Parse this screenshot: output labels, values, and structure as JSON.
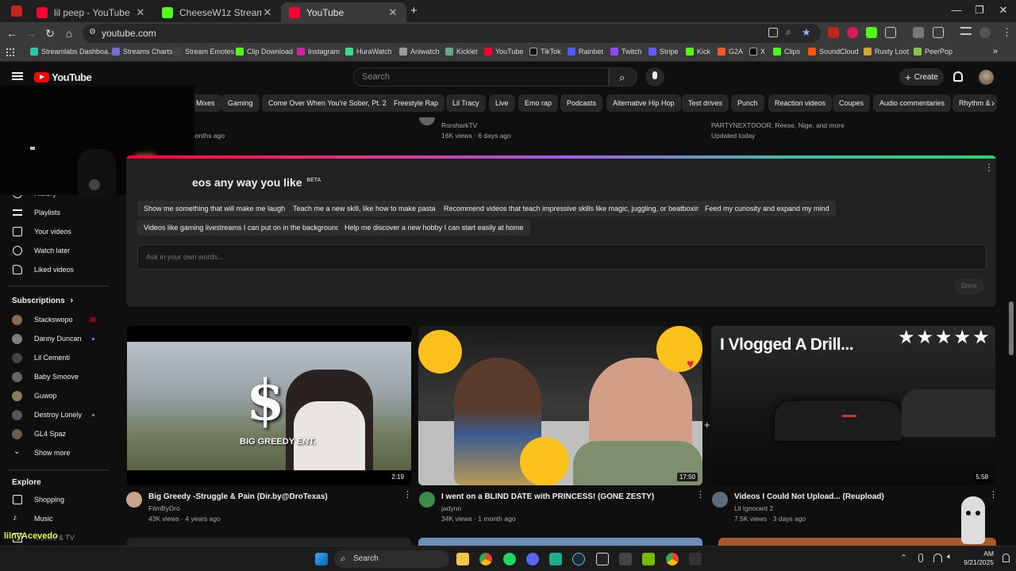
{
  "browser": {
    "tabs": [
      {
        "title": "lil peep - YouTube",
        "active": false
      },
      {
        "title": "CheeseW1z Stream - Watch Live",
        "active": false
      },
      {
        "title": "YouTube",
        "active": true
      }
    ],
    "url": "youtube.com",
    "bookmarks": [
      "Streamlabs Dashboa...",
      "Streams Charts",
      "Stream Emotes",
      "Clip Download",
      "Instagram",
      "HuraWatch",
      "Aniwatch",
      "Kicklet",
      "YouTube",
      "TikTok",
      "Rainbet",
      "Twitch",
      "Stripe",
      "Kick",
      "G2A",
      "X",
      "Clips",
      "SoundCloud",
      "Rusty Loot",
      "PeerPop"
    ]
  },
  "header": {
    "logo": "YouTube",
    "search_placeholder": "Search",
    "create_label": "Create"
  },
  "chips": [
    "Mixes",
    "Gaming",
    "Come Over When You're Sober, Pt. 2",
    "Freestyle Rap",
    "Lil Tracy",
    "Live",
    "Emo rap",
    "Podcasts",
    "Alternative Hip Hop",
    "Test drives",
    "Punch",
    "Reaction videos",
    "Coupes",
    "Audio commentaries",
    "Rhythm &"
  ],
  "top_row": [
    {
      "meta": "nonths ago"
    },
    {
      "channel": "RorsharkTV",
      "meta": "16K views · 6 days ago"
    },
    {
      "channel": "PARTYNEXTDOOR, Reese, Nige, and more",
      "meta": "Updated today"
    }
  ],
  "sidebar": {
    "partial_top": "History",
    "items": [
      "Playlists",
      "Your videos",
      "Watch later",
      "Liked videos"
    ],
    "subscriptions_label": "Subscriptions",
    "subscriptions": [
      {
        "name": "Stackswopo",
        "indicator": "live"
      },
      {
        "name": "Danny Duncan",
        "indicator": "dot"
      },
      {
        "name": "Lil Cementi",
        "indicator": ""
      },
      {
        "name": "Baby Smoove",
        "indicator": ""
      },
      {
        "name": "Guwop",
        "indicator": ""
      },
      {
        "name": "Destroy Lonely",
        "indicator": "dot"
      },
      {
        "name": "GL4 Spaz",
        "indicator": ""
      }
    ],
    "show_more": "Show more",
    "explore_label": "Explore",
    "explore": [
      "Shopping",
      "Music",
      "Movies & TV"
    ]
  },
  "ai_card": {
    "title": "eos any way you like",
    "badge": "BETA",
    "suggestions_row1": [
      "Show me something that will make me laugh",
      "Teach me a new skill, like how to make pasta",
      "Recommend videos that teach impressive skills like magic, juggling, or beatboxing",
      "Feed my curiosity and expand my mind"
    ],
    "suggestions_row2": [
      "Videos like gaming livestreams I can put on in the background",
      "Help me discover a new hobby I can start easily at home"
    ],
    "input_placeholder": "Ask in your own words...",
    "done_label": "Done"
  },
  "videos": [
    {
      "title": "Big Greedy -Struggle & Pain (Dir.by@DroTexas)",
      "channel": "FilmByDro",
      "meta": "43K views · 4 years ago",
      "duration": "2:19",
      "thumb_text": "BIG GREEDY ENT.",
      "thumb_symbol": "$"
    },
    {
      "title": "I went on a BLIND DATE with PRINCESS! (GONE ZESTY)",
      "channel": "jadynn",
      "meta": "34K views · 1 month ago",
      "duration": "17:50"
    },
    {
      "title": "Videos I Could Not Upload... (Reupload)",
      "channel": "Lil Ignorant 2",
      "meta": "7.5K views · 3 days ago",
      "duration": "5:58",
      "thumb_text": "I Vlogged A Drill...",
      "stars": "★★★★★"
    }
  ],
  "overlay_name": "lilnyAcevedo",
  "taskbar": {
    "search_label": "Search",
    "time": "AM",
    "date": "9/21/2025"
  },
  "colors": {
    "yt_red": "#ff0000",
    "background": "#0f0f0f",
    "chip_bg": "#272727"
  }
}
